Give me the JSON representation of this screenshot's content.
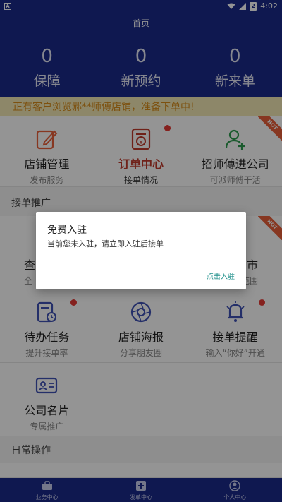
{
  "status_bar": {
    "app_icon": "A",
    "time": "4:02",
    "battery_badge": "2"
  },
  "header": {
    "title": "首页",
    "stats": [
      {
        "value": "0",
        "label": "保障"
      },
      {
        "value": "0",
        "label": "新预约"
      },
      {
        "value": "0",
        "label": "新来单"
      }
    ]
  },
  "notice": "正有客户浏览郝**师傅店铺，准备下单中!",
  "top_grid": [
    {
      "name": "店铺管理",
      "sub": "发布服务",
      "icon": "edit-icon"
    },
    {
      "name": "订单中心",
      "sub": "接单情况",
      "icon": "order-icon"
    },
    {
      "name": "招师傅进公司",
      "sub": "可派师傅干活",
      "icon": "add-user-icon"
    }
  ],
  "hot_badge": "HOT",
  "section_orders": "接单推广",
  "mid_grid_row1": [
    {
      "name": "查",
      "sub": "全"
    },
    {
      "name": "",
      "sub": ""
    },
    {
      "name": "市",
      "sub": "范围"
    }
  ],
  "mid_grid_row2": [
    {
      "name": "待办任务",
      "sub": "提升接单率",
      "icon": "task-icon"
    },
    {
      "name": "店铺海报",
      "sub": "分享朋友圈",
      "icon": "poster-icon"
    },
    {
      "name": "接单提醒",
      "sub": "输入“你好”开通",
      "icon": "bell-icon"
    }
  ],
  "mid_grid_row3": [
    {
      "name": "公司名片",
      "sub": "专属推广",
      "icon": "card-icon"
    }
  ],
  "section_daily": "日常操作",
  "tabbar": [
    {
      "label": "业务中心",
      "icon": "briefcase-icon"
    },
    {
      "label": "发单中心",
      "icon": "plus-icon"
    },
    {
      "label": "个人中心",
      "icon": "user-icon"
    }
  ],
  "dialog": {
    "title": "免费入驻",
    "message": "当前您未入驻，请立即入驻后接单",
    "button": "点击入驻"
  },
  "colors": {
    "primary": "#1b2a8a",
    "accent_red": "#e53935",
    "notice_bg": "#f3e9b6",
    "notice_text": "#d78c1a",
    "dialog_button": "#1d8f8a"
  }
}
